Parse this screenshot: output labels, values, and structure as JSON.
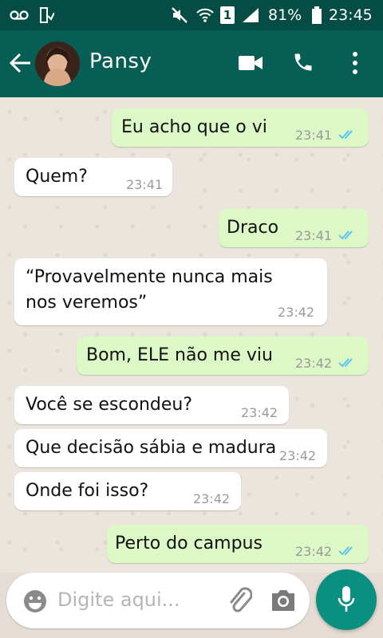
{
  "statusbar": {
    "battery": "81%",
    "time": "23:45",
    "sim": "1",
    "icons": [
      "voicemail-icon",
      "download-icon",
      "mute-icon",
      "wifi-icon",
      "sim-icon",
      "signal-icon",
      "battery-icon"
    ]
  },
  "header": {
    "contact_name": "Pansy",
    "icons": [
      "back-arrow-icon",
      "video-call-icon",
      "phone-call-icon",
      "more-vert-icon"
    ]
  },
  "messages": [
    {
      "dir": "out",
      "lines": [
        "Eu acho que o vi"
      ],
      "time": "23:41",
      "read": true
    },
    {
      "dir": "in",
      "lines": [
        "Quem?"
      ],
      "time": "23:41"
    },
    {
      "dir": "out",
      "lines": [
        "Draco"
      ],
      "time": "23:41",
      "read": true
    },
    {
      "dir": "in",
      "lines": [
        "“Provavelmente nunca mais",
        "nos veremos”"
      ],
      "time": "23:42"
    },
    {
      "dir": "out",
      "lines": [
        "Bom, ELE não me viu"
      ],
      "time": "23:42",
      "read": true
    },
    {
      "dir": "in",
      "lines": [
        "Você se escondeu?"
      ],
      "time": "23:42"
    },
    {
      "dir": "in",
      "lines": [
        "Que decisão sábia e madura"
      ],
      "time": "23:42"
    },
    {
      "dir": "in",
      "lines": [
        "Onde foi isso?"
      ],
      "time": "23:42"
    },
    {
      "dir": "out",
      "lines": [
        "Perto do campus"
      ],
      "time": "23:42",
      "read": true
    }
  ],
  "composer": {
    "placeholder": "Digite aqui...",
    "icons": [
      "emoji-icon",
      "attach-icon",
      "camera-icon",
      "mic-icon"
    ]
  },
  "colors": {
    "statusbar": "#054d44",
    "appbar": "#075e54",
    "outgoing_bubble": "#dcf8c6",
    "incoming_bubble": "#ffffff",
    "read_ticks": "#4fc3f7",
    "mic_button": "#0a8f81"
  }
}
